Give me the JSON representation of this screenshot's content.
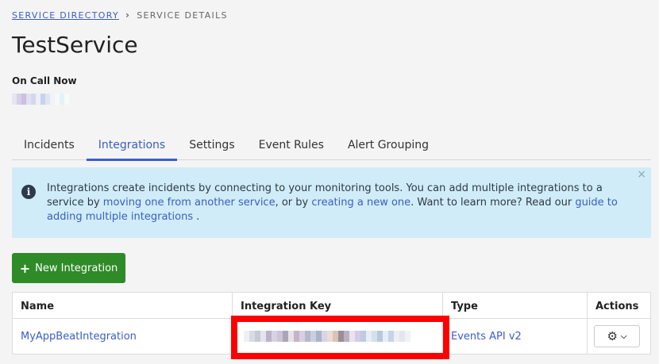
{
  "breadcrumb": {
    "link": "SERVICE DIRECTORY",
    "separator": "›",
    "current": "SERVICE DETAILS"
  },
  "page": {
    "title": "TestService",
    "oncall_label": "On Call Now"
  },
  "tabs": [
    {
      "label": "Incidents",
      "active": false
    },
    {
      "label": "Integrations",
      "active": true
    },
    {
      "label": "Settings",
      "active": false
    },
    {
      "label": "Event Rules",
      "active": false
    },
    {
      "label": "Alert Grouping",
      "active": false
    }
  ],
  "info": {
    "icon": "info-icon",
    "close": "×",
    "text_1": "Integrations create incidents by connecting to your monitoring tools. You can add multiple integrations to a service by ",
    "link_1": "moving one from another service",
    "text_2": ", or by ",
    "link_2": "creating a new one",
    "text_3": ". Want to learn more? Read our ",
    "link_3": "guide to adding multiple integrations",
    "text_4": " ."
  },
  "new_integration_button": {
    "icon": "plus-icon",
    "label": "New Integration"
  },
  "table": {
    "headers": [
      "Name",
      "Integration Key",
      "Type",
      "Actions"
    ],
    "rows": [
      {
        "name": "MyAppBeatIntegration",
        "type": "Events API v2"
      }
    ]
  },
  "colors": {
    "accent": "#3b5ec4",
    "button_green": "#2e8b28",
    "info_bg": "#d0ecf8",
    "highlight_red": "#ff0000"
  }
}
